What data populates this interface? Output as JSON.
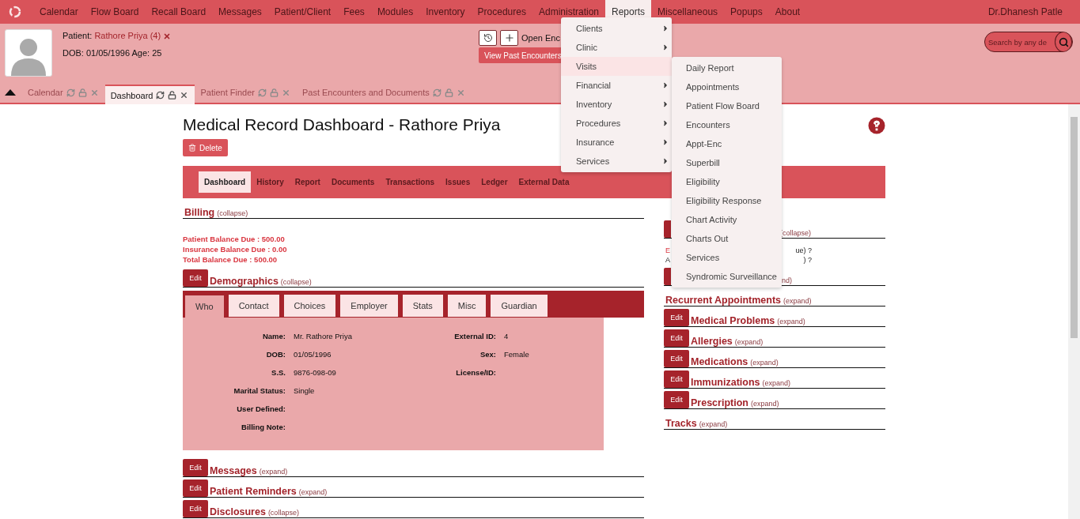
{
  "menu": {
    "items": [
      {
        "label": "Calendar",
        "selected": false
      },
      {
        "label": "Flow Board",
        "selected": false
      },
      {
        "label": "Recall Board",
        "selected": false
      },
      {
        "label": "Messages",
        "selected": false
      },
      {
        "label": "Patient/Client",
        "selected": false
      },
      {
        "label": "Fees",
        "selected": false
      },
      {
        "label": "Modules",
        "selected": false
      },
      {
        "label": "Inventory",
        "selected": false
      },
      {
        "label": "Procedures",
        "selected": false
      },
      {
        "label": "Administration",
        "selected": false
      },
      {
        "label": "Reports",
        "selected": true
      },
      {
        "label": "Miscellaneous",
        "selected": false
      },
      {
        "label": "Popups",
        "selected": false
      },
      {
        "label": "About",
        "selected": false
      }
    ],
    "user": "Dr.Dhanesh Patle"
  },
  "reports_menu": [
    {
      "label": "Clients",
      "submenu": true,
      "selected": false
    },
    {
      "label": "Clinic",
      "submenu": true,
      "selected": false
    },
    {
      "label": "Visits",
      "submenu": false,
      "selected": true
    },
    {
      "label": "Financial",
      "submenu": true,
      "selected": false
    },
    {
      "label": "Inventory",
      "submenu": true,
      "selected": false
    },
    {
      "label": "Procedures",
      "submenu": true,
      "selected": false
    },
    {
      "label": "Insurance",
      "submenu": true,
      "selected": false
    },
    {
      "label": "Services",
      "submenu": true,
      "selected": false
    }
  ],
  "visits_submenu": [
    "Daily Report",
    "Appointments",
    "Patient Flow Board",
    "Encounters",
    "Appt-Enc",
    "Superbill",
    "Eligibility",
    "Eligibility Response",
    "Chart Activity",
    "Charts Out",
    "Services",
    "Syndromic Surveillance"
  ],
  "patient": {
    "label": "Patient:",
    "name": "Rathore Priya (4)",
    "dob": "DOB: 01/05/1996 Age: 25"
  },
  "encounter": {
    "open_label": "Open Enc",
    "past_button": "View Past Encounters"
  },
  "search": {
    "placeholder": "Search by any de"
  },
  "tabs": [
    {
      "label": "Calendar",
      "selected": false
    },
    {
      "label": "Dashboard",
      "selected": true
    },
    {
      "label": "Patient Finder",
      "selected": false
    },
    {
      "label": "Past Encounters and Documents",
      "selected": false
    }
  ],
  "title": "Medical Record Dashboard - Rathore Priya",
  "delete_button": "Delete",
  "nav": [
    {
      "label": "Dashboard",
      "selected": true
    },
    {
      "label": "History",
      "selected": false
    },
    {
      "label": "Report",
      "selected": false
    },
    {
      "label": "Documents",
      "selected": false
    },
    {
      "label": "Transactions",
      "selected": false
    },
    {
      "label": "Issues",
      "selected": false
    },
    {
      "label": "Ledger",
      "selected": false
    },
    {
      "label": "External Data",
      "selected": false
    }
  ],
  "billing": {
    "title": "Billing",
    "toggle": "(collapse)",
    "lines": [
      "Patient Balance Due : 500.00",
      "Insurance Balance Due : 0.00",
      "Total Balance Due : 500.00"
    ]
  },
  "demographics": {
    "edit": "Edit",
    "title": "Demographics",
    "toggle": "(collapse)",
    "tabs": [
      {
        "label": "Who",
        "selected": true
      },
      {
        "label": "Contact",
        "selected": false
      },
      {
        "label": "Choices",
        "selected": false
      },
      {
        "label": "Employer",
        "selected": false
      },
      {
        "label": "Stats",
        "selected": false
      },
      {
        "label": "Misc",
        "selected": false
      },
      {
        "label": "Guardian",
        "selected": false
      }
    ],
    "left_fields": [
      {
        "label": "Name:",
        "value": "Mr. Rathore  Priya"
      },
      {
        "label": "DOB:",
        "value": "01/05/1996"
      },
      {
        "label": "S.S.",
        "value": "9876-098-09"
      },
      {
        "label": "Marital Status:",
        "value": "Single"
      },
      {
        "label": "User Defined:"
      },
      {
        "label": "Billing Note:"
      }
    ],
    "right_fields": [
      {
        "label": "External ID:",
        "value": "4"
      },
      {
        "label": "Sex:",
        "value": "Female"
      },
      {
        "label": "License/ID:"
      }
    ]
  },
  "left_sections": [
    {
      "edit": "Edit",
      "title": "Messages",
      "toggle": "(expand)"
    },
    {
      "edit": "Edit",
      "title": "Patient Reminders",
      "toggle": "(expand)"
    },
    {
      "edit": "Edit",
      "title": "Disclosures",
      "toggle": "(collapse)"
    }
  ],
  "right_partial": {
    "toggle": "(collapse)",
    "lines": [
      {
        "start": "E",
        "end": "ue) ?"
      },
      {
        "start": "A",
        "end": ") ?"
      }
    ],
    "second_toggle": "nd)"
  },
  "right_sections": [
    {
      "title": "Recurrent Appointments",
      "toggle": "(expand)"
    },
    {
      "edit": "Edit",
      "title": "Medical Problems",
      "toggle": "(expand)"
    },
    {
      "edit": "Edit",
      "title": "Allergies",
      "toggle": "(expand)"
    },
    {
      "edit": "Edit",
      "title": "Medications",
      "toggle": "(expand)"
    },
    {
      "edit": "Edit",
      "title": "Immunizations",
      "toggle": "(expand)"
    },
    {
      "edit": "Edit",
      "title": "Prescription",
      "toggle": "(expand)"
    },
    {
      "title": "Tracks",
      "toggle": "(expand)"
    }
  ]
}
